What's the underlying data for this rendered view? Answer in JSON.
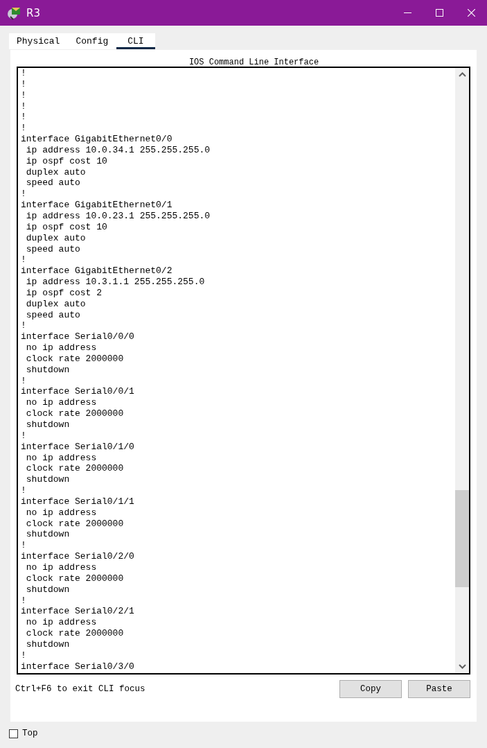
{
  "window": {
    "title": "R3"
  },
  "tabs": [
    {
      "label": "Physical",
      "selected": false
    },
    {
      "label": "Config",
      "selected": false
    },
    {
      "label": "CLI",
      "selected": true
    }
  ],
  "cli": {
    "heading": "IOS Command Line Interface",
    "lines": [
      "!",
      "!",
      "!",
      "!",
      "!",
      "!",
      "interface GigabitEthernet0/0",
      " ip address 10.0.34.1 255.255.255.0",
      " ip ospf cost 10",
      " duplex auto",
      " speed auto",
      "!",
      "interface GigabitEthernet0/1",
      " ip address 10.0.23.1 255.255.255.0",
      " ip ospf cost 10",
      " duplex auto",
      " speed auto",
      "!",
      "interface GigabitEthernet0/2",
      " ip address 10.3.1.1 255.255.255.0",
      " ip ospf cost 2",
      " duplex auto",
      " speed auto",
      "!",
      "interface Serial0/0/0",
      " no ip address",
      " clock rate 2000000",
      " shutdown",
      "!",
      "interface Serial0/0/1",
      " no ip address",
      " clock rate 2000000",
      " shutdown",
      "!",
      "interface Serial0/1/0",
      " no ip address",
      " clock rate 2000000",
      " shutdown",
      "!",
      "interface Serial0/1/1",
      " no ip address",
      " clock rate 2000000",
      " shutdown",
      "!",
      "interface Serial0/2/0",
      " no ip address",
      " clock rate 2000000",
      " shutdown",
      "!",
      "interface Serial0/2/1",
      " no ip address",
      " clock rate 2000000",
      " shutdown",
      "!",
      "interface Serial0/3/0"
    ]
  },
  "hint": "Ctrl+F6 to exit CLI focus",
  "buttons": [
    "Copy",
    "Paste"
  ],
  "top_checkbox": {
    "label": "Top",
    "checked": false
  }
}
